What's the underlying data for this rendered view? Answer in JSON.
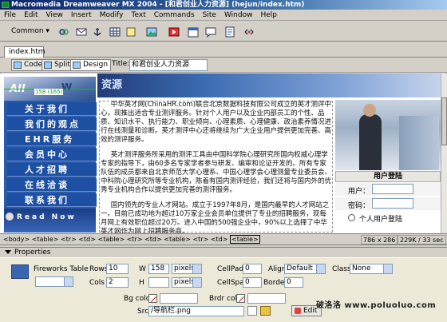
{
  "window": {
    "title": "Macromedia Dreamweaver MX 2004 - [和君创业人力资源] (hejun/index.htm)"
  },
  "menu": [
    "File",
    "Edit",
    "View",
    "Insert",
    "Modify",
    "Text",
    "Commands",
    "Site",
    "Window",
    "Help"
  ],
  "insertbar": {
    "category": "Common"
  },
  "document": {
    "tab": "index.htm",
    "views": [
      "Code",
      "Split",
      "Design"
    ],
    "active_view": "Design",
    "title_label": "Title:",
    "title_value": "和君创业人力资源"
  },
  "page": {
    "banner_text": "资源",
    "nav_width_label": "158 (165)",
    "nav_items": [
      "关于我们",
      "我们的观点",
      "EHR服务",
      "会员中心",
      "人才招聘",
      "在线洽谈",
      "联系我们"
    ],
    "read_now": "Read Now",
    "paragraphs": [
      "中华英才网(ChinaHR.com)联合北京数据科技有限公司成立的英才测评中心，现推出适合专业测评服务。针对个人用户以及企业内部员工的个性、品质、知识水平、执行能力、职业倾向、心理素质、心理健康、政治素养情况进行在线测量和诊断。英才测评中心还将继续为广大企业用户提供更加完善、高效的测评服务。",
      "英才测评服务所采用的测评工具由中国科学院心理研究所国内权威心理学专家的指导下，由60多名专家学者参与研发、编审和论证开发的。所有专家队伍的成员都来自北京师范大学心理系、中国心理学会心理测量专业委员会、中科院心理研究所等专业机构，陈着有国内测评经验，我们还将与国内外的优秀专业机构合作以提供更加完善的测评服务。",
      "国内领先的专业人才网站。成立于1997年8月，是国内最早的人才网站之一。目前已成功地为超过10万家企业会员单位提供了专业的招聘服务，现每月网上有效职位超过20万。进入中国的500强企业中，90%以上选择了中华英才网作为网上招聘服务商。"
    ],
    "login": {
      "header": "用户登陆",
      "user_label": "用户：",
      "password_label": "密码：",
      "personal_login": "个人用户登陆"
    }
  },
  "statusbar": {
    "tags": "<body> <table> <tr> <td> <table> <tr> <td> <table> <tr> <td>",
    "selected_tag": "<table>",
    "size": "786 x 286",
    "download": "229K / 33 sec"
  },
  "properties": {
    "panel_title": "Properties",
    "element_type": "Fireworks Table",
    "rows_label": "Rows",
    "rows": "10",
    "cols_label": "Cols",
    "cols": "2",
    "w_label": "W",
    "w": "158",
    "w_unit": "pixels",
    "h_label": "H",
    "h": "",
    "h_unit": "pixels",
    "cellpad_label": "CellPad",
    "cellpad": "0",
    "cellspace_label": "CellSpace",
    "cellspace": "0",
    "align_label": "Align",
    "align": "Default",
    "border_label": "Border",
    "border": "0",
    "class_label": "Class",
    "class": "None",
    "bgcolor_label": "Bg color",
    "brdrcolor_label": "Brdr color",
    "src_label": "Src",
    "src": "/导航栏.png",
    "edit_label": "Edit"
  },
  "watermark": "破洛洛 www.poluoluo.com"
}
